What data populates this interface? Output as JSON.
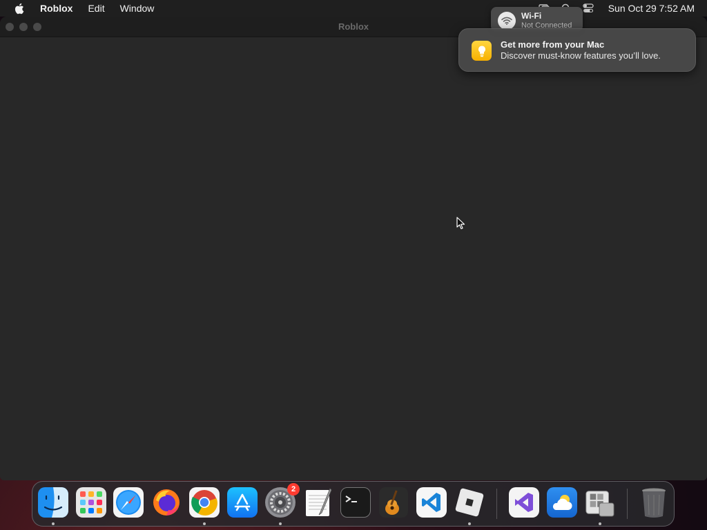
{
  "menubar": {
    "apple_icon": "apple-logo-icon",
    "app_name": "Roblox",
    "menus": [
      "Edit",
      "Window"
    ],
    "status_icons": [
      "display-icon",
      "search-icon",
      "control-center-icon"
    ],
    "datetime": "Sun Oct 29  7:52 AM"
  },
  "window": {
    "title": "Roblox"
  },
  "wifi": {
    "name": "Wi-Fi",
    "status": "Not Connected"
  },
  "notification": {
    "icon": "lightbulb-icon",
    "title": "Get more from your Mac",
    "body": "Discover must-know features you’ll love."
  },
  "dock": {
    "apps": [
      {
        "name": "Finder",
        "icon": "finder-icon",
        "running": true
      },
      {
        "name": "Launchpad",
        "icon": "launchpad-icon",
        "running": false
      },
      {
        "name": "Safari",
        "icon": "safari-icon",
        "running": false
      },
      {
        "name": "Firefox",
        "icon": "firefox-icon",
        "running": false
      },
      {
        "name": "Google Chrome",
        "icon": "chrome-icon",
        "running": true
      },
      {
        "name": "App Store",
        "icon": "app-store-icon",
        "running": false
      },
      {
        "name": "System Settings",
        "icon": "system-settings-icon",
        "running": true,
        "badge": "2"
      },
      {
        "name": "TextEdit",
        "icon": "textedit-icon",
        "running": false
      },
      {
        "name": "Terminal",
        "icon": "terminal-icon",
        "running": false
      },
      {
        "name": "GarageBand",
        "icon": "garageband-icon",
        "running": false
      },
      {
        "name": "Visual Studio Code",
        "icon": "vscode-icon",
        "running": false
      },
      {
        "name": "Roblox",
        "icon": "roblox-icon",
        "running": true
      },
      {
        "name": "Visual Studio",
        "icon": "visual-studio-icon",
        "running": false
      },
      {
        "name": "Weather",
        "icon": "weather-icon",
        "running": false
      },
      {
        "name": "Boot Camp Assistant",
        "icon": "bootcamp-icon",
        "running": true
      },
      {
        "name": "Trash",
        "icon": "trash-icon",
        "running": false
      }
    ]
  },
  "colors": {
    "menubar_bg": "#1f1f1f",
    "window_bg": "#282828",
    "titlebar_bg": "#1e1e1e",
    "badge": "#ff3b30",
    "notif_icon": "#f7b000"
  }
}
